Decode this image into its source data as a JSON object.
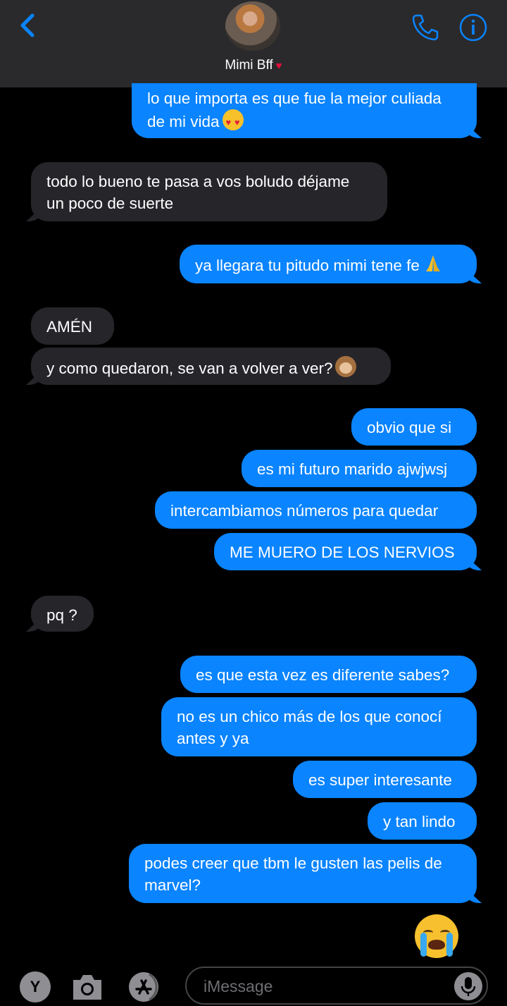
{
  "header": {
    "contact_name": "Mimi Bff",
    "contact_emoji_icon": "kiss-lips-icon",
    "back_icon": "chevron-left-icon",
    "call_icon": "phone-icon",
    "info_icon": "info-icon"
  },
  "messages": [
    {
      "from": "me",
      "text": "lo que importa es que fue la mejor culiada",
      "text2": "de mi vida",
      "emoji": "heart-eyes"
    },
    {
      "from": "them",
      "text": "todo lo bueno te pasa a vos boludo déjame",
      "text2": "un poco de suerte"
    },
    {
      "from": "me",
      "text": "ya llegara tu pitudo mimi tene fe",
      "emoji": "praying-hands"
    },
    {
      "from": "them",
      "text": "AMÉN"
    },
    {
      "from": "them",
      "text": "y como quedaron, se van a volver a ver?",
      "emoji": "see-no-evil-monkey"
    },
    {
      "from": "me",
      "text": "obvio que si"
    },
    {
      "from": "me",
      "text": "es mi futuro marido ajwjwsj"
    },
    {
      "from": "me",
      "text": "intercambiamos números para quedar"
    },
    {
      "from": "me",
      "text": "ME MUERO DE LOS NERVIOS"
    },
    {
      "from": "them",
      "text": "pq ?"
    },
    {
      "from": "me",
      "text": "es que esta vez es diferente sabes?"
    },
    {
      "from": "me",
      "text": "no es un chico más de los que conocí",
      "text2": "antes y ya"
    },
    {
      "from": "me",
      "text": "es super interesante"
    },
    {
      "from": "me",
      "text": "y tan lindo"
    },
    {
      "from": "me",
      "text": "podes creer que tbm le gusten las pelis de",
      "text2": "marvel?"
    },
    {
      "from": "me",
      "emoji": "loudly-crying-face"
    }
  ],
  "compose": {
    "app_letter": "Y",
    "placeholder": "iMessage",
    "camera_icon": "camera-icon",
    "appstore_icon": "app-store-icon",
    "mic_icon": "microphone-icon"
  },
  "colors": {
    "sent": "#0a84ff",
    "received": "#26252a",
    "header": "#2a2a2c",
    "accent": "#0a84ff"
  }
}
